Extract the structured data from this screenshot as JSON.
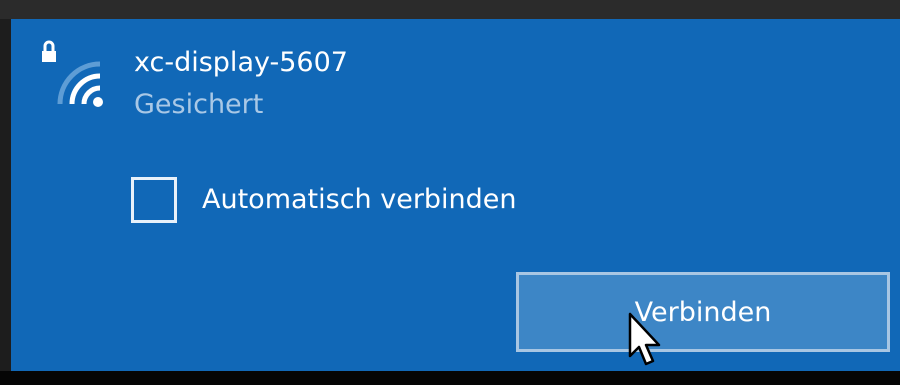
{
  "network": {
    "name": "xc-display-5607",
    "status": "Gesichert",
    "icon": "wifi-secured-icon"
  },
  "auto_connect": {
    "label": "Automatisch verbinden",
    "checked": false
  },
  "connect_button": {
    "label": "Verbinden"
  },
  "colors": {
    "panel_background": "#1168b7",
    "button_background": "#3d86c6",
    "button_border": "#a8c6e3",
    "status_text": "#a9c8e6"
  }
}
